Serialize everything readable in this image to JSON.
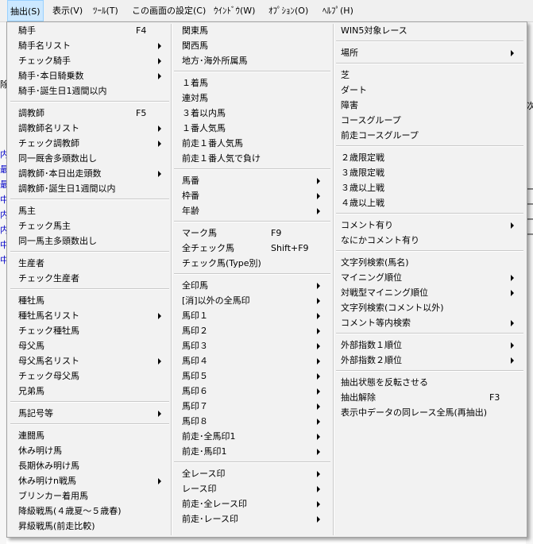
{
  "menubar": {
    "items": [
      "抽出(S)",
      "表示(V)",
      "ﾂｰﾙ(T)",
      "この画面の設定(C)",
      "ｳｲﾝﾄﾞｳ(W)",
      "ｵﾌﾟｼｮﾝ(O)",
      "ﾍﾙﾌﾟ(H)"
    ]
  },
  "background": {
    "left_fragments": [
      "除",
      "内",
      "最",
      "最",
      "中",
      "内",
      "内",
      "中",
      "中"
    ],
    "right_fragments": [
      "次",
      "一",
      "一",
      "一",
      "一"
    ]
  },
  "dropdown": {
    "columns": [
      {
        "groups": [
          [
            {
              "label": "騎手",
              "shortcut": "F4"
            },
            {
              "label": "騎手名リスト",
              "submenu": true
            },
            {
              "label": "チェック騎手",
              "submenu": true
            },
            {
              "label": "騎手･本日騎乗数",
              "submenu": true
            },
            {
              "label": "騎手･誕生日1週間以内"
            }
          ],
          [
            {
              "label": "調教師",
              "shortcut": "F5"
            },
            {
              "label": "調教師名リスト",
              "submenu": true
            },
            {
              "label": "チェック調教師",
              "submenu": true
            },
            {
              "label": "同一厩舎多頭数出し"
            },
            {
              "label": "調教師･本日出走頭数",
              "submenu": true
            },
            {
              "label": "調教師･誕生日1週間以内"
            }
          ],
          [
            {
              "label": "馬主"
            },
            {
              "label": "チェック馬主"
            },
            {
              "label": "同一馬主多頭数出し"
            }
          ],
          [
            {
              "label": "生産者"
            },
            {
              "label": "チェック生産者"
            }
          ],
          [
            {
              "label": "種牡馬"
            },
            {
              "label": "種牡馬名リスト",
              "submenu": true
            },
            {
              "label": "チェック種牡馬"
            },
            {
              "label": "母父馬"
            },
            {
              "label": "母父馬名リスト",
              "submenu": true
            },
            {
              "label": "チェック母父馬"
            },
            {
              "label": "兄弟馬"
            }
          ],
          [
            {
              "label": "馬記号等",
              "submenu": true
            }
          ],
          [
            {
              "label": "連闘馬"
            },
            {
              "label": "休み明け馬"
            },
            {
              "label": "長期休み明け馬"
            },
            {
              "label": "休み明けn戦馬",
              "submenu": true
            },
            {
              "label": "ブリンカー着用馬"
            },
            {
              "label": "降級戦馬(４歳夏～５歳春)"
            },
            {
              "label": "昇級戦馬(前走比較)"
            }
          ]
        ]
      },
      {
        "groups": [
          [
            {
              "label": "関東馬"
            },
            {
              "label": "関西馬"
            },
            {
              "label": "地方･海外所属馬"
            }
          ],
          [
            {
              "label": "１着馬"
            },
            {
              "label": "連対馬"
            },
            {
              "label": "３着以内馬"
            },
            {
              "label": "１番人気馬"
            },
            {
              "label": "前走１番人気馬"
            },
            {
              "label": "前走１番人気で負け"
            }
          ],
          [
            {
              "label": "馬番",
              "submenu": true
            },
            {
              "label": "枠番",
              "submenu": true
            },
            {
              "label": "年齢",
              "submenu": true
            }
          ],
          [
            {
              "label": "マーク馬",
              "shortcut": "F9"
            },
            {
              "label": "全チェック馬",
              "shortcut": "Shift+F9"
            },
            {
              "label": "チェック馬(Type別)"
            }
          ],
          [
            {
              "label": "全印馬",
              "submenu": true
            },
            {
              "label": "[消]以外の全馬印",
              "submenu": true
            },
            {
              "label": "馬印１",
              "submenu": true
            },
            {
              "label": "馬印２",
              "submenu": true
            },
            {
              "label": "馬印３",
              "submenu": true
            },
            {
              "label": "馬印４",
              "submenu": true
            },
            {
              "label": "馬印５",
              "submenu": true
            },
            {
              "label": "馬印６",
              "submenu": true
            },
            {
              "label": "馬印７",
              "submenu": true
            },
            {
              "label": "馬印８",
              "submenu": true
            },
            {
              "label": "前走･全馬印1",
              "submenu": true
            },
            {
              "label": "前走･馬印1",
              "submenu": true
            }
          ],
          [
            {
              "label": "全レース印",
              "submenu": true
            },
            {
              "label": "レース印",
              "submenu": true
            },
            {
              "label": "前走･全レース印",
              "submenu": true
            },
            {
              "label": "前走･レース印",
              "submenu": true
            }
          ]
        ]
      },
      {
        "groups": [
          [
            {
              "label": "WIN5対象レース"
            }
          ],
          [
            {
              "label": "場所",
              "submenu": true
            }
          ],
          [
            {
              "label": "芝"
            },
            {
              "label": "ダート"
            },
            {
              "label": "障害"
            },
            {
              "label": "コースグループ"
            },
            {
              "label": "前走コースグループ"
            }
          ],
          [
            {
              "label": "２歳限定戦"
            },
            {
              "label": "３歳限定戦"
            },
            {
              "label": "３歳以上戦"
            },
            {
              "label": "４歳以上戦"
            }
          ],
          [
            {
              "label": "コメント有り",
              "submenu": true
            },
            {
              "label": "なにかコメント有り"
            }
          ],
          [
            {
              "label": "文字列検索(馬名)"
            },
            {
              "label": "マイニング順位",
              "submenu": true
            },
            {
              "label": "対戦型マイニング順位",
              "submenu": true
            },
            {
              "label": "文字列検索(コメント以外)"
            },
            {
              "label": "コメント等内検索",
              "submenu": true
            }
          ],
          [
            {
              "label": "外部指数１順位",
              "submenu": true
            },
            {
              "label": "外部指数２順位",
              "submenu": true
            }
          ],
          [
            {
              "label": "抽出状態を反転させる"
            },
            {
              "label": "抽出解除",
              "shortcut": "F3"
            },
            {
              "label": "表示中データの同レース全馬(再抽出)"
            }
          ]
        ]
      }
    ]
  }
}
